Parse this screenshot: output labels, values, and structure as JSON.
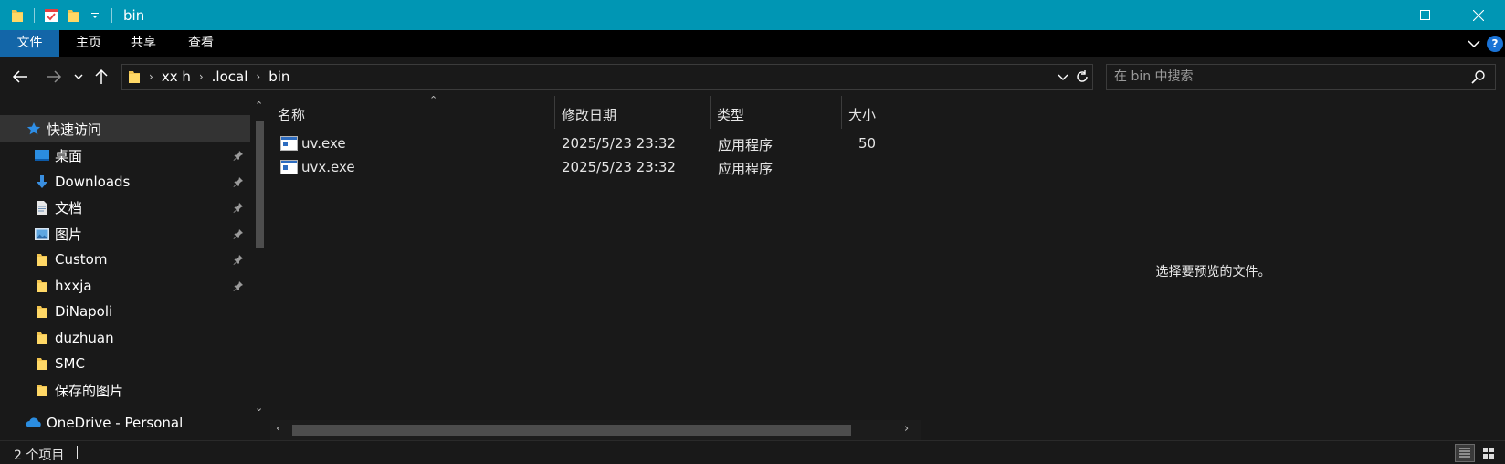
{
  "window": {
    "title": "bin",
    "accent": "#0096b4"
  },
  "quick_access_toolbar": {
    "icons": [
      "folder-icon",
      "properties-icon",
      "new-folder-icon",
      "customize-dropdown-icon"
    ]
  },
  "window_controls": [
    "minimize-icon",
    "maximize-icon",
    "close-icon"
  ],
  "ribbon": {
    "tabs": [
      {
        "label": "文件",
        "active": true
      },
      {
        "label": "主页",
        "active": false
      },
      {
        "label": "共享",
        "active": false
      },
      {
        "label": "查看",
        "active": false
      }
    ],
    "help_label": "?"
  },
  "address_bar": {
    "breadcrumbs": [
      "xx h",
      ".local",
      "bin"
    ]
  },
  "search": {
    "placeholder": "在 bin 中搜索"
  },
  "nav_pane": {
    "items": [
      {
        "label": "快速访问",
        "icon": "star-icon",
        "pinned": false,
        "selected": true
      },
      {
        "label": "桌面",
        "icon": "desktop-icon",
        "pinned": true
      },
      {
        "label": "Downloads",
        "icon": "download-icon",
        "pinned": true
      },
      {
        "label": "文档",
        "icon": "document-icon",
        "pinned": true
      },
      {
        "label": "图片",
        "icon": "pictures-icon",
        "pinned": true
      },
      {
        "label": "Custom",
        "icon": "folder-icon",
        "pinned": true
      },
      {
        "label": "hxxja",
        "icon": "folder-icon",
        "pinned": true
      },
      {
        "label": "DiNapoli",
        "icon": "folder-icon",
        "pinned": false
      },
      {
        "label": "duzhuan",
        "icon": "folder-icon",
        "pinned": false
      },
      {
        "label": "SMC",
        "icon": "folder-icon",
        "pinned": false
      },
      {
        "label": "保存的图片",
        "icon": "folder-icon",
        "pinned": false
      },
      {
        "label": "OneDrive - Personal",
        "icon": "cloud-icon",
        "pinned": false
      }
    ]
  },
  "file_list": {
    "columns": [
      "名称",
      "修改日期",
      "类型",
      "大小"
    ],
    "rows": [
      {
        "name": "uv.exe",
        "modified": "2025/5/23 23:32",
        "type": "应用程序",
        "size": "50"
      },
      {
        "name": "uvx.exe",
        "modified": "2025/5/23 23:32",
        "type": "应用程序",
        "size": ""
      }
    ]
  },
  "preview": {
    "message": "选择要预览的文件。"
  },
  "status_bar": {
    "item_count": "2 个项目"
  }
}
